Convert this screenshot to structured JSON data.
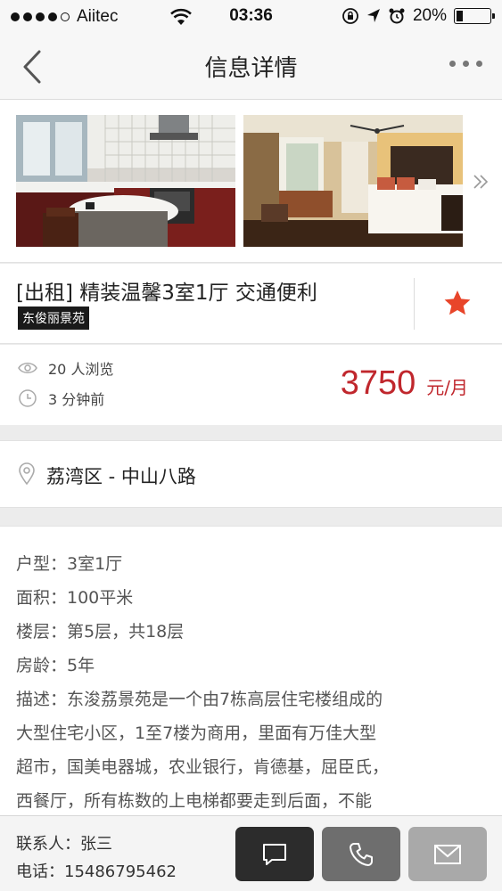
{
  "status_bar": {
    "carrier": "Aiitec",
    "time": "03:36",
    "battery": "20%",
    "battery_level": 0.2
  },
  "nav": {
    "title": "信息详情"
  },
  "photos": {
    "items": [
      {
        "alt": "kitchen"
      },
      {
        "alt": "bedroom"
      }
    ]
  },
  "listing": {
    "title": "[出租] 精装温馨3室1厅 交通便利",
    "estate_tag": "东俊丽景苑",
    "favorited": true
  },
  "stats": {
    "views": "20 人浏览",
    "posted": "3 分钟前",
    "price": "3750",
    "price_unit": "元/月"
  },
  "location": {
    "text": "荔湾区 - 中山八路"
  },
  "details": {
    "lines": [
      "户型：3室1厅",
      "面积：100平米",
      "楼层：第5层，共18层",
      "房龄：5年",
      "描述：东浚荔景苑是一个由7栋高层住宅楼组成的",
      "大型住宅小区，1至7楼为商用，里面有万佳大型",
      "超市，国美电器城，农业银行，肯德基，屈臣氏，",
      "西餐厅，所有栋数的上电梯都要走到后面，不能"
    ]
  },
  "contact": {
    "name": "联系人：张三",
    "phone": "电话：15486795462"
  },
  "colors": {
    "price": "#c0272d",
    "star": "#e8452a",
    "chat_button": "#2c2c2c",
    "call_button": "#6e6e6e",
    "mail_button": "#a9a9a9"
  },
  "icons": [
    "back-icon",
    "more-icon",
    "chevron-right-icon",
    "star-icon",
    "eye-icon",
    "clock-icon",
    "location-pin-icon",
    "chat-icon",
    "phone-icon",
    "mail-icon",
    "wifi-icon",
    "lock-rotation-icon",
    "location-arrow-icon",
    "alarm-icon",
    "battery-icon"
  ]
}
